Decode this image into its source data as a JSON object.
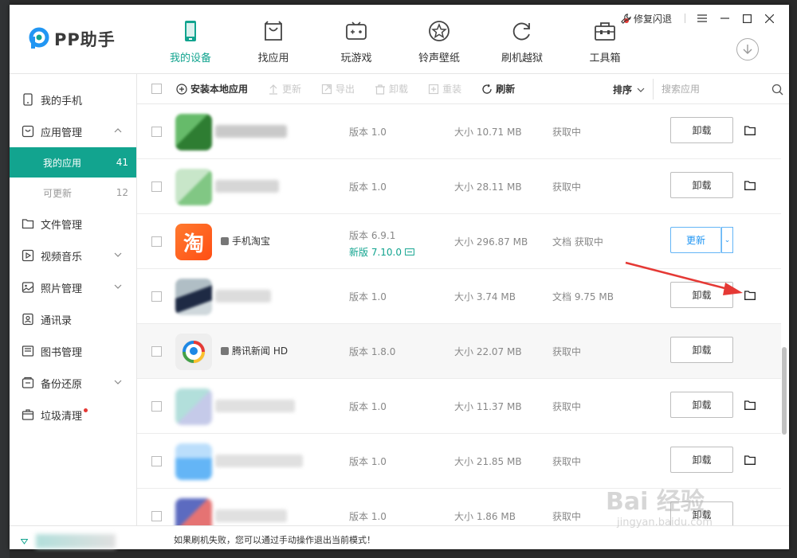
{
  "app": {
    "logo_text": "PP助手",
    "titlebar": {
      "repair_label": "修复闪退",
      "menu_icon": "menu-icon",
      "min_icon": "minimize-icon",
      "max_icon": "maximize-icon",
      "close_icon": "close-icon"
    }
  },
  "nav": [
    {
      "label": "我的设备",
      "icon": "phone-icon",
      "active": true
    },
    {
      "label": "找应用",
      "icon": "bag-icon"
    },
    {
      "label": "玩游戏",
      "icon": "gamepad-icon"
    },
    {
      "label": "铃声壁纸",
      "icon": "star-icon"
    },
    {
      "label": "刷机越狱",
      "icon": "refresh-icon"
    },
    {
      "label": "工具箱",
      "icon": "toolbox-icon",
      "badge_dot": true
    }
  ],
  "sidebar": {
    "items": [
      {
        "label": "我的手机",
        "icon": "phone-icon"
      },
      {
        "label": "应用管理",
        "icon": "app-icon",
        "expanded": true
      },
      {
        "label": "文件管理",
        "icon": "folder-icon"
      },
      {
        "label": "视频音乐",
        "icon": "play-icon",
        "has_chevron": true
      },
      {
        "label": "照片管理",
        "icon": "photo-icon",
        "has_chevron": true
      },
      {
        "label": "通讯录",
        "icon": "contacts-icon"
      },
      {
        "label": "图书管理",
        "icon": "book-icon"
      },
      {
        "label": "备份还原",
        "icon": "backup-icon",
        "has_chevron": true
      },
      {
        "label": "垃圾清理",
        "icon": "trash-icon",
        "badge_dot": true
      }
    ],
    "subitems": [
      {
        "label": "我的应用",
        "count": "41",
        "active": true
      },
      {
        "label": "可更新",
        "count": "12"
      }
    ]
  },
  "toolbar": {
    "install_label": "安装本地应用",
    "update_label": "更新",
    "export_label": "导出",
    "uninstall_label": "卸载",
    "reinstall_label": "重装",
    "refresh_label": "刷新",
    "sort_label": "排序",
    "search_placeholder": "搜索应用"
  },
  "apps": [
    {
      "name": "",
      "version": "版本 1.0",
      "size": "大小 10.71 MB",
      "doc": "获取中",
      "action": "卸载",
      "icon_colors": [
        "#5cb85c",
        "#2e9e2e"
      ]
    },
    {
      "name": "",
      "version": "版本 1.0",
      "size": "大小 28.11 MB",
      "doc": "获取中",
      "action": "卸载",
      "icon_colors": [
        "#a5d6a7",
        "#81c784"
      ]
    },
    {
      "name": "手机淘宝",
      "version": "版本 6.9.1",
      "new_version": "新版 7.10.0",
      "size": "大小 296.87 MB",
      "doc": "文档 获取中",
      "action": "更新",
      "icon_char": "淘",
      "icon_colors": [
        "#ff5722",
        "#ff7a2f"
      ]
    },
    {
      "name": "",
      "version": "版本 1.0",
      "size": "大小 3.74 MB",
      "doc": "文档 9.75 MB",
      "action": "卸载",
      "icon_colors": [
        "#90a4c8",
        "#1e2a44"
      ]
    },
    {
      "name": "腾讯新闻 HD",
      "version": "版本 1.8.0",
      "size": "大小 22.07 MB",
      "doc": "获取中",
      "action": "卸载",
      "icon_colors": [
        "#e0e0e0",
        "#e53935"
      ]
    },
    {
      "name": "",
      "version": "版本 1.0",
      "size": "大小 11.37 MB",
      "doc": "获取中",
      "action": "卸载",
      "icon_colors": [
        "#b2dfdb",
        "#c5cae9"
      ]
    },
    {
      "name": "",
      "version": "版本 1.0",
      "size": "大小 21.85 MB",
      "doc": "获取中",
      "action": "卸载",
      "icon_colors": [
        "#90caf9",
        "#64b5f6"
      ]
    },
    {
      "name": "",
      "version": "版本 1.0",
      "size": "大小 1.86 MB",
      "doc": "获取中",
      "action": "卸载",
      "icon_colors": [
        "#5c6bc0",
        "#e57373"
      ]
    }
  ],
  "status": {
    "message": "如果刷机失败，您可以通过手动操作退出当前模式！"
  },
  "watermark": {
    "main": "Bai 经验",
    "sub": "jingyan.baidu.com"
  },
  "colors": {
    "accent": "#12a48f",
    "update_blue": "#2196f3",
    "badge_red": "#e53935",
    "annotation_red": "#e53935"
  }
}
